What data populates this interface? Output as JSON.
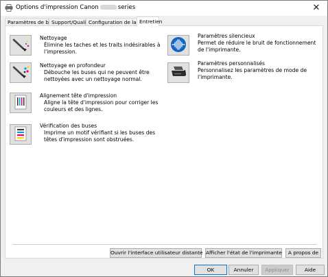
{
  "window": {
    "title_prefix": "Options d'impression Canon",
    "title_suffix": "series",
    "close_glyph": "✕"
  },
  "tabs": [
    {
      "label": "Paramètres de base"
    },
    {
      "label": "Support/Qualité"
    },
    {
      "label": "Configuration de la page"
    },
    {
      "label": "Entretien"
    }
  ],
  "maintenance": {
    "cleaning": {
      "name": "Nettoyage",
      "desc": "Élimine les taches et les traits indésirables à l'impression.",
      "icon": "cleaning-icon"
    },
    "deep_cleaning": {
      "name": "Nettoyage en profondeur",
      "desc": "Débouche les buses qui ne peuvent être nettoyées avec un nettoyage normal.",
      "icon": "deep-cleaning-icon"
    },
    "alignment": {
      "name": "Alignement tête d'impression",
      "desc": "Aligne la tête d'impression pour corriger les couleurs et des lignes.",
      "icon": "alignment-icon"
    },
    "nozzle_check": {
      "name": "Vérification des buses",
      "desc": "Imprime un motif vérifiant si les buses des têtes d'impression sont obstruées.",
      "icon": "nozzle-check-icon"
    },
    "quiet": {
      "name": "Paramètres silencieux",
      "desc": "Permet de réduire le bruit de fonctionnement de l'imprimante.",
      "icon": "quiet-icon"
    },
    "custom": {
      "name": "Paramètres personnalisés",
      "desc": "Personnalisez les paramètres de mode de l'imprimante.",
      "icon": "printer-icon"
    }
  },
  "panel_buttons": {
    "remote_ui": "Ouvrir l'interface utilisateur distante",
    "status": "Afficher l'état de l'imprimante",
    "about": "A propos de"
  },
  "dialog_buttons": {
    "ok": "OK",
    "cancel": "Annuler",
    "apply": "Appliquer",
    "help": "Aide"
  },
  "colors": {
    "accent": "#0078d7",
    "quiet_icon": "#1565c0"
  }
}
